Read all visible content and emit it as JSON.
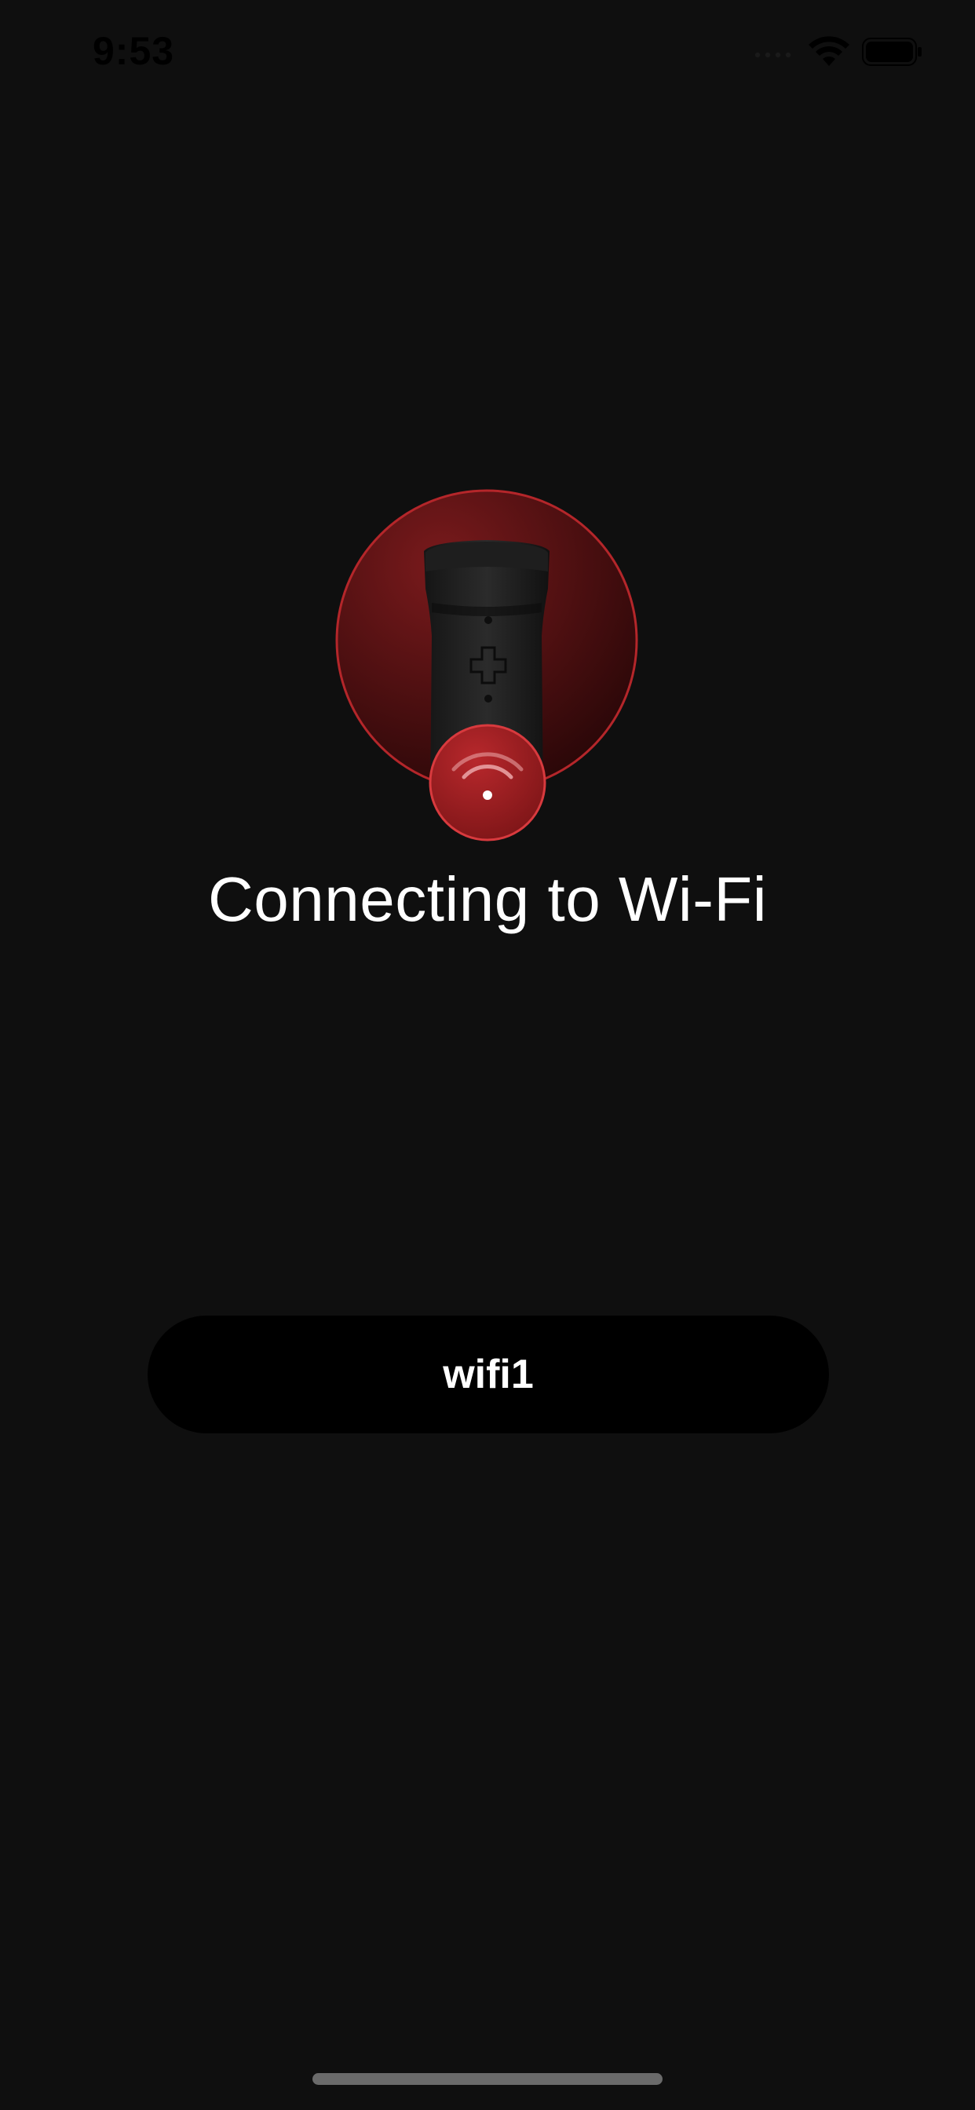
{
  "status_bar": {
    "time": "9:53",
    "wifi_icon": "wifi-icon",
    "battery_icon": "battery-icon",
    "signal_icon": "cellular-signal-icon"
  },
  "illustration": {
    "device_icon": "device-illustration",
    "badge_icon": "wifi-badge-icon",
    "accent_color": "#b4262a",
    "accent_dark": "#5a1012"
  },
  "main": {
    "title": "Connecting to Wi-Fi",
    "network_name": "wifi1"
  }
}
